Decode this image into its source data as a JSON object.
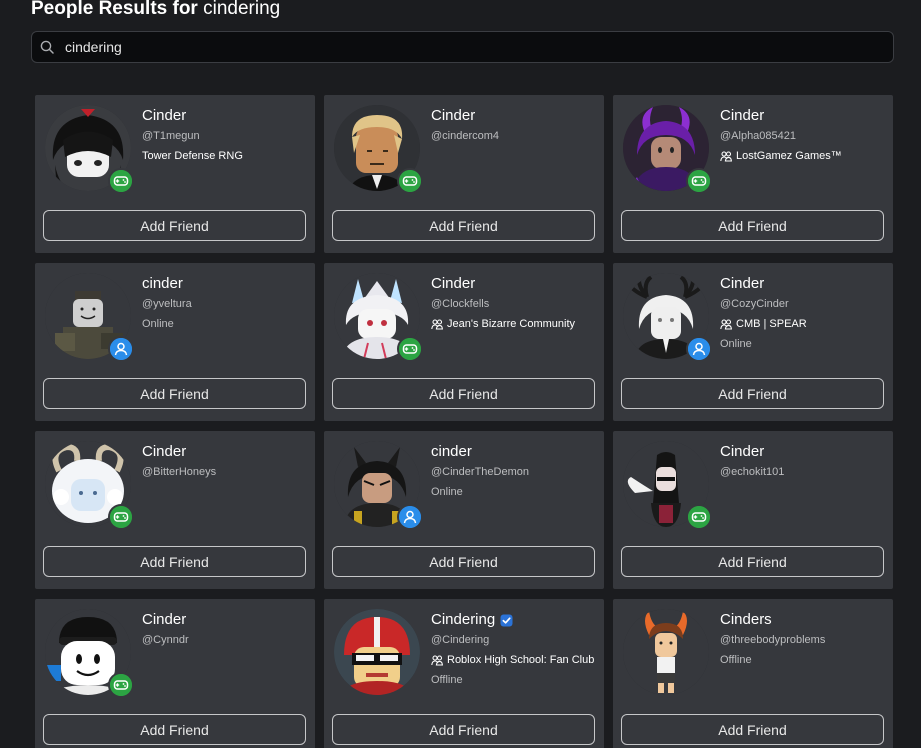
{
  "header": {
    "prefix": "People Results for",
    "query": "cindering"
  },
  "search": {
    "value": "cindering"
  },
  "colors": {
    "page_background": "#1b1c1f",
    "card_background": "#36383d",
    "game_presence": "#2ca443",
    "online_presence": "#2a8dea",
    "verified_badge": "#2b73d8"
  },
  "button_label": "Add Friend",
  "results": [
    {
      "display_name": "Cinder",
      "username": "@T1megun",
      "detail": "Tower Defense RNG",
      "detail_has_group_icon": false,
      "status": "",
      "presence": "game",
      "verified": false,
      "avatar": "dark-hair-avatar"
    },
    {
      "display_name": "Cinder",
      "username": "@cindercom4",
      "detail": "",
      "detail_has_group_icon": false,
      "status": "",
      "presence": "game",
      "verified": false,
      "avatar": "blonde-hair-avatar"
    },
    {
      "display_name": "Cinder",
      "username": "@Alpha085421",
      "detail": "LostGamez Games™",
      "detail_has_group_icon": true,
      "status": "",
      "presence": "game",
      "verified": false,
      "avatar": "purple-horns-avatar"
    },
    {
      "display_name": "cinder",
      "username": "@yveltura",
      "detail": "",
      "detail_has_group_icon": false,
      "status": "Online",
      "presence": "online",
      "verified": false,
      "avatar": "soldier-avatar"
    },
    {
      "display_name": "Cinder",
      "username": "@Clockfells",
      "detail": "Jean's Bizarre Community",
      "detail_has_group_icon": true,
      "status": "",
      "presence": "game",
      "verified": false,
      "avatar": "white-horned-avatar"
    },
    {
      "display_name": "Cinder",
      "username": "@CozyCinder",
      "detail": "CMB | SPEAR",
      "detail_has_group_icon": true,
      "status": "Online",
      "presence": "online",
      "verified": false,
      "avatar": "antler-avatar"
    },
    {
      "display_name": "Cinder",
      "username": "@BitterHoneys",
      "detail": "",
      "detail_has_group_icon": false,
      "status": "",
      "presence": "game",
      "verified": false,
      "avatar": "ram-horns-avatar"
    },
    {
      "display_name": "cinder",
      "username": "@CinderTheDemon",
      "detail": "",
      "detail_has_group_icon": false,
      "status": "Online",
      "presence": "online",
      "verified": false,
      "avatar": "demon-avatar"
    },
    {
      "display_name": "Cinder",
      "username": "@echokit101",
      "detail": "",
      "detail_has_group_icon": false,
      "status": "",
      "presence": "game",
      "verified": false,
      "avatar": "winged-avatar"
    },
    {
      "display_name": "Cinder",
      "username": "@Cynndr",
      "detail": "",
      "detail_has_group_icon": false,
      "status": "",
      "presence": "game",
      "verified": false,
      "avatar": "beanie-avatar"
    },
    {
      "display_name": "Cindering",
      "username": "@Cindering",
      "detail": "Roblox High School: Fan Club",
      "detail_has_group_icon": true,
      "status": "Offline",
      "presence": "none",
      "verified": true,
      "avatar": "helmet-avatar"
    },
    {
      "display_name": "Cinders",
      "username": "@threebodyproblems",
      "detail": "",
      "detail_has_group_icon": false,
      "status": "Offline",
      "presence": "none",
      "verified": false,
      "avatar": "fire-hair-avatar"
    }
  ]
}
